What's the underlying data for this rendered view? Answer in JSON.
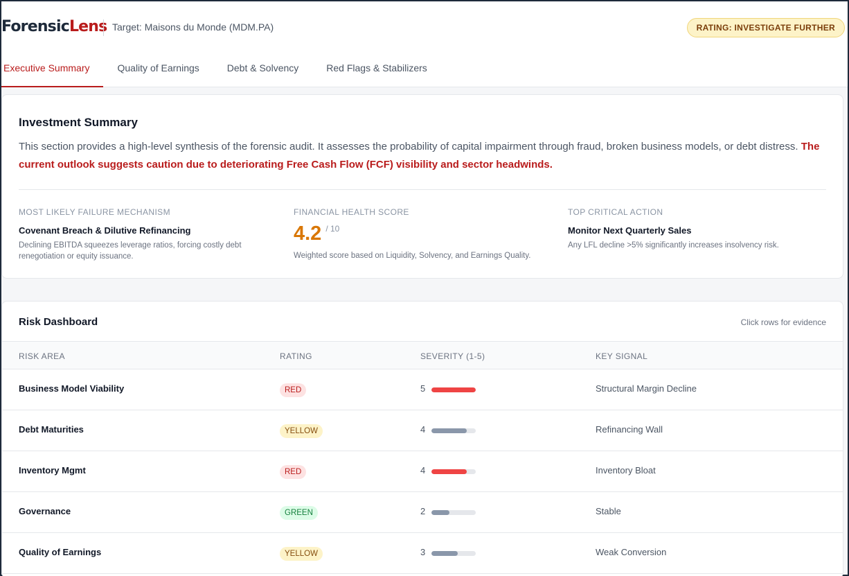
{
  "app": {
    "brand_part1": "Forensic",
    "brand_part2": "Lens",
    "target": "Target: Maisons du Monde (MDM.PA)",
    "rating": "RATING: INVESTIGATE FURTHER"
  },
  "tabs": [
    {
      "label": "Executive Summary",
      "active": true
    },
    {
      "label": "Quality of Earnings",
      "active": false
    },
    {
      "label": "Debt & Solvency",
      "active": false
    },
    {
      "label": "Red Flags & Stabilizers",
      "active": false
    }
  ],
  "summary": {
    "title": "Investment Summary",
    "text": "This section provides a high-level synthesis of the forensic audit. It assesses the probability of capital impairment through fraud, broken business models, or debt distress. ",
    "alert": "The current outlook suggests caution due to deteriorating Free Cash Flow (FCF) visibility and sector headwinds.",
    "metrics": {
      "failure": {
        "label": "MOST LIKELY FAILURE MECHANISM",
        "title": "Covenant Breach & Dilutive Refinancing",
        "text": "Declining EBITDA squeezes leverage ratios, forcing costly debt renegotiation or equity issuance."
      },
      "health": {
        "label": "FINANCIAL HEALTH SCORE",
        "score": "4.2",
        "max": "/ 10",
        "text": "Weighted score based on Liquidity, Solvency, and Earnings Quality."
      },
      "action": {
        "label": "TOP CRITICAL ACTION",
        "title": "Monitor Next Quarterly Sales",
        "text": "Any LFL decline >5% significantly increases insolvency risk."
      }
    }
  },
  "risk": {
    "title": "Risk Dashboard",
    "hint": "Click rows for evidence",
    "columns": [
      "RISK AREA",
      "RATING",
      "SEVERITY (1-5)",
      "KEY SIGNAL"
    ],
    "colors": {
      "red": "#ef4444",
      "gray": "#8a97aa"
    },
    "rows": [
      {
        "area": "Business Model Viability",
        "rating": "RED",
        "severity": "5",
        "fill": 1.0,
        "bar_color": "red",
        "signal": "Structural Margin Decline"
      },
      {
        "area": "Debt Maturities",
        "rating": "YELLOW",
        "severity": "4",
        "fill": 0.8,
        "bar_color": "gray",
        "signal": "Refinancing Wall"
      },
      {
        "area": "Inventory Mgmt",
        "rating": "RED",
        "severity": "4",
        "fill": 0.8,
        "bar_color": "red",
        "signal": "Inventory Bloat"
      },
      {
        "area": "Governance",
        "rating": "GREEN",
        "severity": "2",
        "fill": 0.4,
        "bar_color": "gray",
        "signal": "Stable"
      },
      {
        "area": "Quality of Earnings",
        "rating": "YELLOW",
        "severity": "3",
        "fill": 0.6,
        "bar_color": "gray",
        "signal": "Weak Conversion"
      }
    ]
  }
}
